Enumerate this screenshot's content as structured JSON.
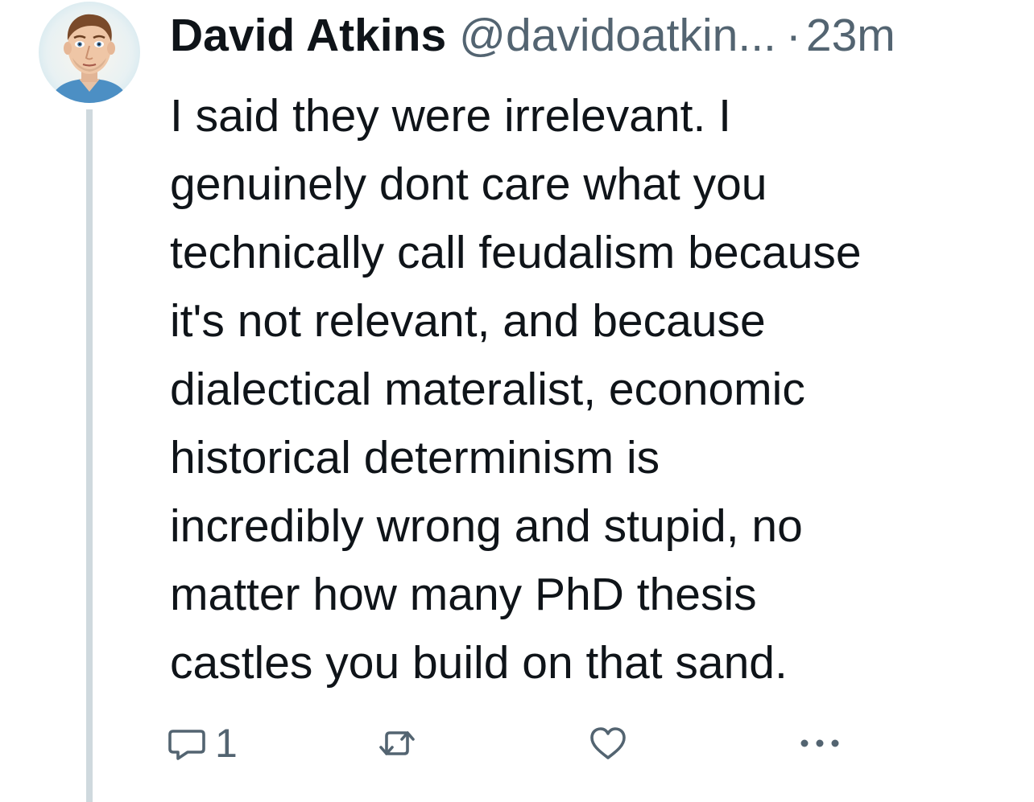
{
  "tweet": {
    "author": {
      "display_name": "David Atkins",
      "handle": "@davidoatkin...",
      "avatar_icon": "cartoon-portrait-avatar"
    },
    "separator": "·",
    "timestamp": "23m",
    "text_lines": [
      "I said they were irrelevant. I",
      "genuinely dont care what you",
      "technically call feudalism because",
      "it's not relevant, and because",
      "dialectical materalist, economic",
      "historical determinism is",
      "incredibly wrong and stupid, no",
      "matter how many PhD thesis",
      "castles you build on that sand."
    ],
    "actions": {
      "reply": {
        "icon": "reply-icon",
        "count": "1"
      },
      "retweet": {
        "icon": "retweet-icon"
      },
      "like": {
        "icon": "heart-icon"
      },
      "more": {
        "icon": "more-icon"
      }
    }
  },
  "colors": {
    "text": "#0f1419",
    "secondary": "#536471",
    "thread_line": "#cfd9de",
    "background": "#ffffff"
  }
}
